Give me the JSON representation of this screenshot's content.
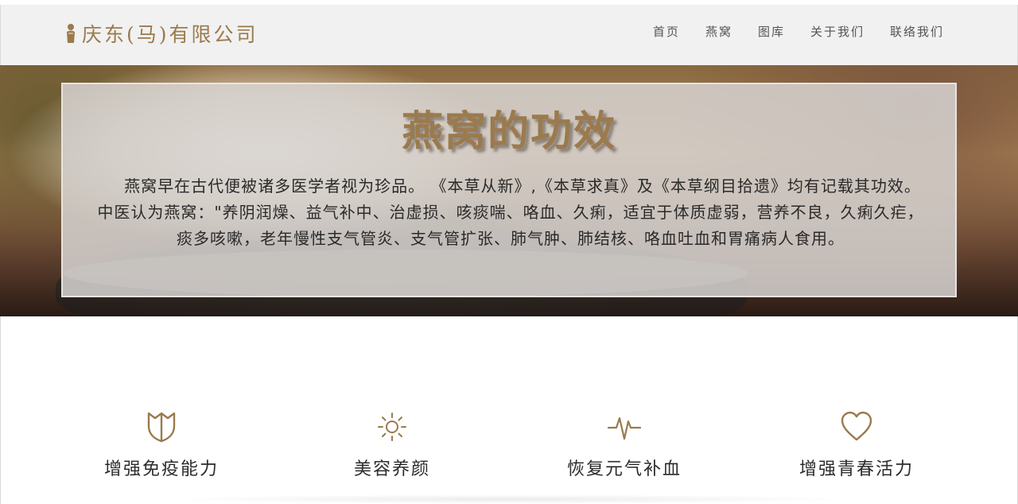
{
  "header": {
    "brand": "庆东(马)有限公司",
    "nav": [
      {
        "label": "首页"
      },
      {
        "label": "燕窝"
      },
      {
        "label": "图库"
      },
      {
        "label": "关于我们"
      },
      {
        "label": "联络我们"
      }
    ]
  },
  "hero": {
    "title": "燕窝的功效",
    "text": "燕窝早在古代便被诸多医学者视为珍品。 《本草从新》,《本草求真》及《本草纲目拾遗》均有记载其功效。中医认为燕窝：\"养阴润燥、益气补中、治虚损、咳痰喘、咯血、久痢，适宜于体质虚弱，营养不良，久痢久疟，痰多咳嗽，老年慢性支气管炎、支气管扩张、肺气肿、肺结核、咯血吐血和胃痛病人食用。"
  },
  "features": [
    {
      "icon": "shield-icon",
      "label": "增强免疫能力"
    },
    {
      "icon": "sun-icon",
      "label": "美容养颜"
    },
    {
      "icon": "pulse-icon",
      "label": "恢复元气补血"
    },
    {
      "icon": "heart-icon",
      "label": "增强青春活力"
    }
  ],
  "colors": {
    "accent": "#9b7a4d",
    "header_bg": "#f1f1f1",
    "panel_bg": "#d6d3d0"
  }
}
